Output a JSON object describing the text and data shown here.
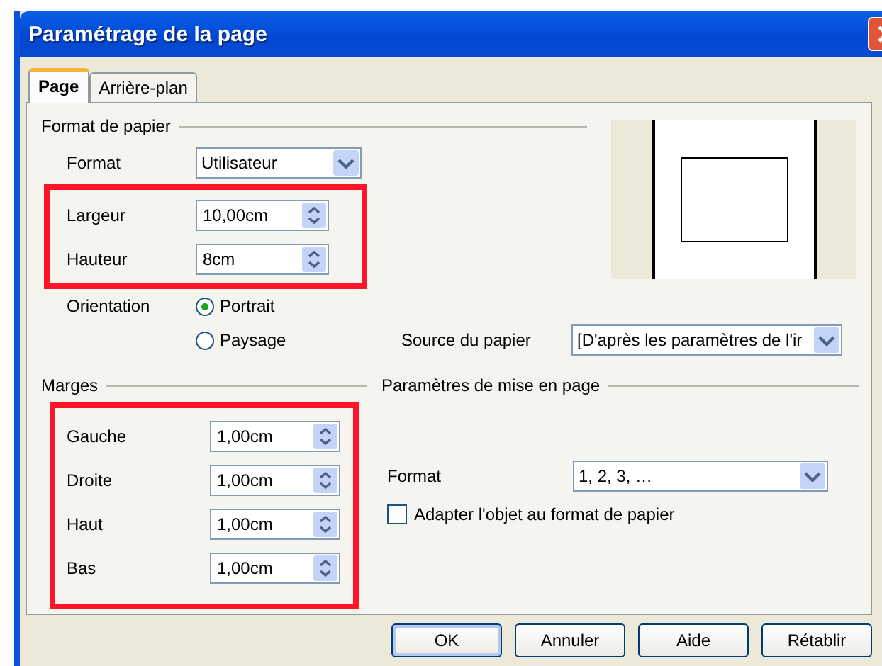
{
  "window": {
    "title": "Paramétrage de la page"
  },
  "tabs": [
    {
      "label": "Page",
      "selected": true
    },
    {
      "label": "Arrière-plan",
      "selected": false
    }
  ],
  "paper_format": {
    "heading": "Format de papier",
    "format": {
      "label": "Format",
      "value": "Utilisateur"
    },
    "size": {
      "highlighted": true,
      "fields": [
        {
          "label": "Largeur",
          "value": "10,00cm"
        },
        {
          "label": "Hauteur",
          "value": "8cm"
        }
      ]
    },
    "orientation": {
      "label": "Orientation",
      "options": [
        {
          "label": "Portrait",
          "selected": true
        },
        {
          "label": "Paysage",
          "selected": false
        }
      ]
    },
    "paper_source": {
      "label": "Source du papier",
      "value": "[D'après les paramètres de l'ir"
    }
  },
  "margins": {
    "heading": "Marges",
    "highlighted": true,
    "fields": [
      {
        "label": "Gauche",
        "value": "1,00cm"
      },
      {
        "label": "Droite",
        "value": "1,00cm"
      },
      {
        "label": "Haut",
        "value": "1,00cm"
      },
      {
        "label": "Bas",
        "value": "1,00cm"
      }
    ]
  },
  "layout_settings": {
    "heading": "Paramètres de mise en page",
    "format": {
      "label": "Format",
      "value": "1, 2, 3, …"
    },
    "fit_object": {
      "label": "Adapter l'objet au format de papier",
      "checked": false
    }
  },
  "buttons": [
    {
      "label": "OK",
      "default": true
    },
    {
      "label": "Annuler",
      "default": false
    },
    {
      "label": "Aide",
      "default": false
    },
    {
      "label": "Rétablir",
      "default": false
    }
  ]
}
